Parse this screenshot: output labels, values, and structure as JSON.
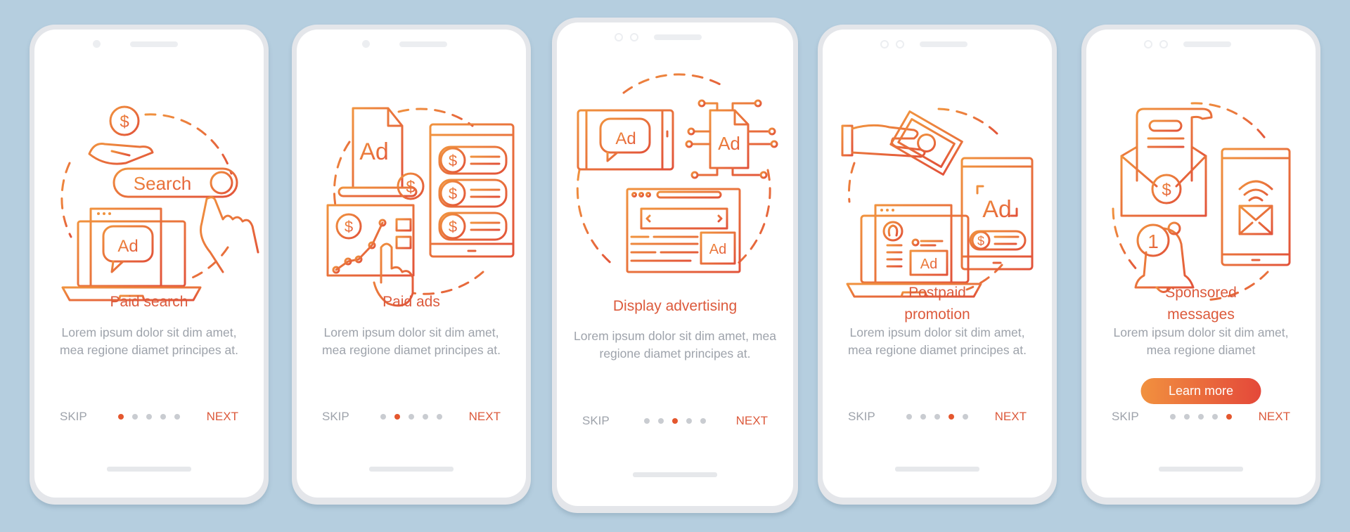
{
  "background_color": "#b5cedf",
  "accent_gradient": [
    "#f1913f",
    "#e4483a"
  ],
  "title_color": "#dc5a3c",
  "body_text_color": "#9ea3ab",
  "cards": [
    {
      "title": "Paid search",
      "title_lines": [
        "Paid search"
      ],
      "description": "Lorem ipsum dolor sit dim amet, mea regione diamet principes at.",
      "skip_label": "SKIP",
      "next_label": "NEXT",
      "page_index": 1,
      "page_count": 5,
      "illustration": {
        "icons": [
          "hand-coin-icon",
          "search-bar-icon",
          "pointer-hand-icon",
          "laptop-ad-icon"
        ],
        "search_label": "Search",
        "ad_label": "Ad"
      }
    },
    {
      "title": "Paid ads",
      "title_lines": [
        "Paid ads"
      ],
      "description": "Lorem ipsum dolor sit dim amet, mea regione diamet principes at.",
      "skip_label": "SKIP",
      "next_label": "NEXT",
      "page_index": 2,
      "page_count": 5,
      "illustration": {
        "icons": [
          "ad-document-icon",
          "analytics-board-icon",
          "tablet-payments-icon"
        ],
        "ad_label": "Ad"
      }
    },
    {
      "title": "Display advertising",
      "title_lines": [
        "Display advertising"
      ],
      "description": "Lorem ipsum dolor sit dim amet, mea regione diamet principes at.",
      "skip_label": "SKIP",
      "next_label": "NEXT",
      "page_index": 3,
      "page_count": 5,
      "illustration": {
        "icons": [
          "phone-ad-bubble-icon",
          "ad-circuit-icon",
          "browser-ad-icon"
        ],
        "ad_label": "Ad"
      }
    },
    {
      "title": "Postpaid promotion",
      "title_lines": [
        "Postpaid",
        "promotion"
      ],
      "description": "Lorem ipsum dolor sit dim amet, mea regione diamet principes at.",
      "skip_label": "SKIP",
      "next_label": "NEXT",
      "page_index": 4,
      "page_count": 5,
      "illustration": {
        "icons": [
          "hand-money-icon",
          "laptop-profile-ad-icon",
          "tablet-ad-icon"
        ],
        "ad_label": "Ad"
      }
    },
    {
      "title": "Sponsored messages",
      "title_lines": [
        "Sponsored",
        "messages"
      ],
      "description": "Lorem ipsum dolor sit dim amet, mea regione diamet",
      "button_label": "Learn more",
      "skip_label": "SKIP",
      "next_label": "NEXT",
      "page_index": 5,
      "page_count": 5,
      "illustration": {
        "icons": [
          "envelope-invoice-icon",
          "notification-bell-icon",
          "phone-mail-icon"
        ],
        "badge_number": "1"
      }
    }
  ]
}
